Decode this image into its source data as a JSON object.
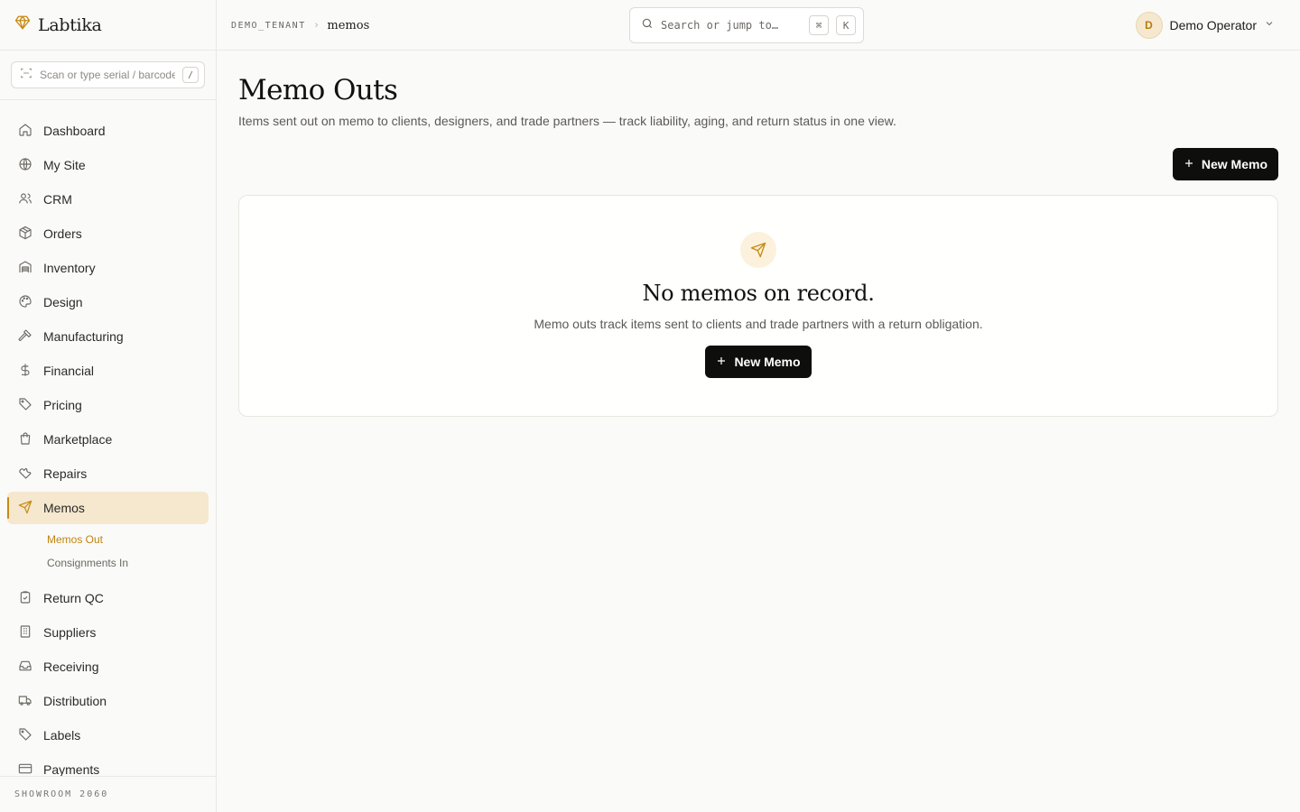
{
  "brand": {
    "name": "Labtika"
  },
  "scan": {
    "placeholder": "Scan or type serial / barcode",
    "shortcut": "/"
  },
  "sidebar": {
    "items": [
      {
        "label": "Dashboard",
        "icon": "home-icon"
      },
      {
        "label": "My Site",
        "icon": "globe-icon"
      },
      {
        "label": "CRM",
        "icon": "users-icon"
      },
      {
        "label": "Orders",
        "icon": "package-icon"
      },
      {
        "label": "Inventory",
        "icon": "warehouse-icon"
      },
      {
        "label": "Design",
        "icon": "palette-icon"
      },
      {
        "label": "Manufacturing",
        "icon": "hammer-icon"
      },
      {
        "label": "Financial",
        "icon": "dollar-icon"
      },
      {
        "label": "Pricing",
        "icon": "tag-icon"
      },
      {
        "label": "Marketplace",
        "icon": "shopping-bag-icon"
      },
      {
        "label": "Repairs",
        "icon": "wrench-icon"
      },
      {
        "label": "Memos",
        "icon": "send-icon",
        "active": true
      },
      {
        "label": "Return QC",
        "icon": "clipboard-check-icon"
      },
      {
        "label": "Suppliers",
        "icon": "building-icon"
      },
      {
        "label": "Receiving",
        "icon": "inbox-icon"
      },
      {
        "label": "Distribution",
        "icon": "truck-icon"
      },
      {
        "label": "Labels",
        "icon": "tag-icon"
      },
      {
        "label": "Payments",
        "icon": "credit-card-icon"
      }
    ],
    "memos_sub": [
      "Memos Out",
      "Consignments In"
    ],
    "footer": "SHOWROOM 2060"
  },
  "breadcrumb": {
    "tenant": "DEMO_TENANT",
    "page": "memos"
  },
  "search": {
    "placeholder": "Search or jump to…",
    "key1": "⌘",
    "key2": "K"
  },
  "user": {
    "initial": "D",
    "name": "Demo Operator"
  },
  "page": {
    "title": "Memo Outs",
    "subtitle": "Items sent out on memo to clients, designers, and trade partners — track liability, aging, and return status in one view.",
    "new_button": "New Memo"
  },
  "empty": {
    "title": "No memos on record.",
    "subtitle": "Memo outs track items sent to clients and trade partners with a return obligation.",
    "button": "New Memo"
  },
  "colors": {
    "accent": "#c88a12",
    "active_bg": "#f5e8cf",
    "button": "#0e0e0d"
  }
}
